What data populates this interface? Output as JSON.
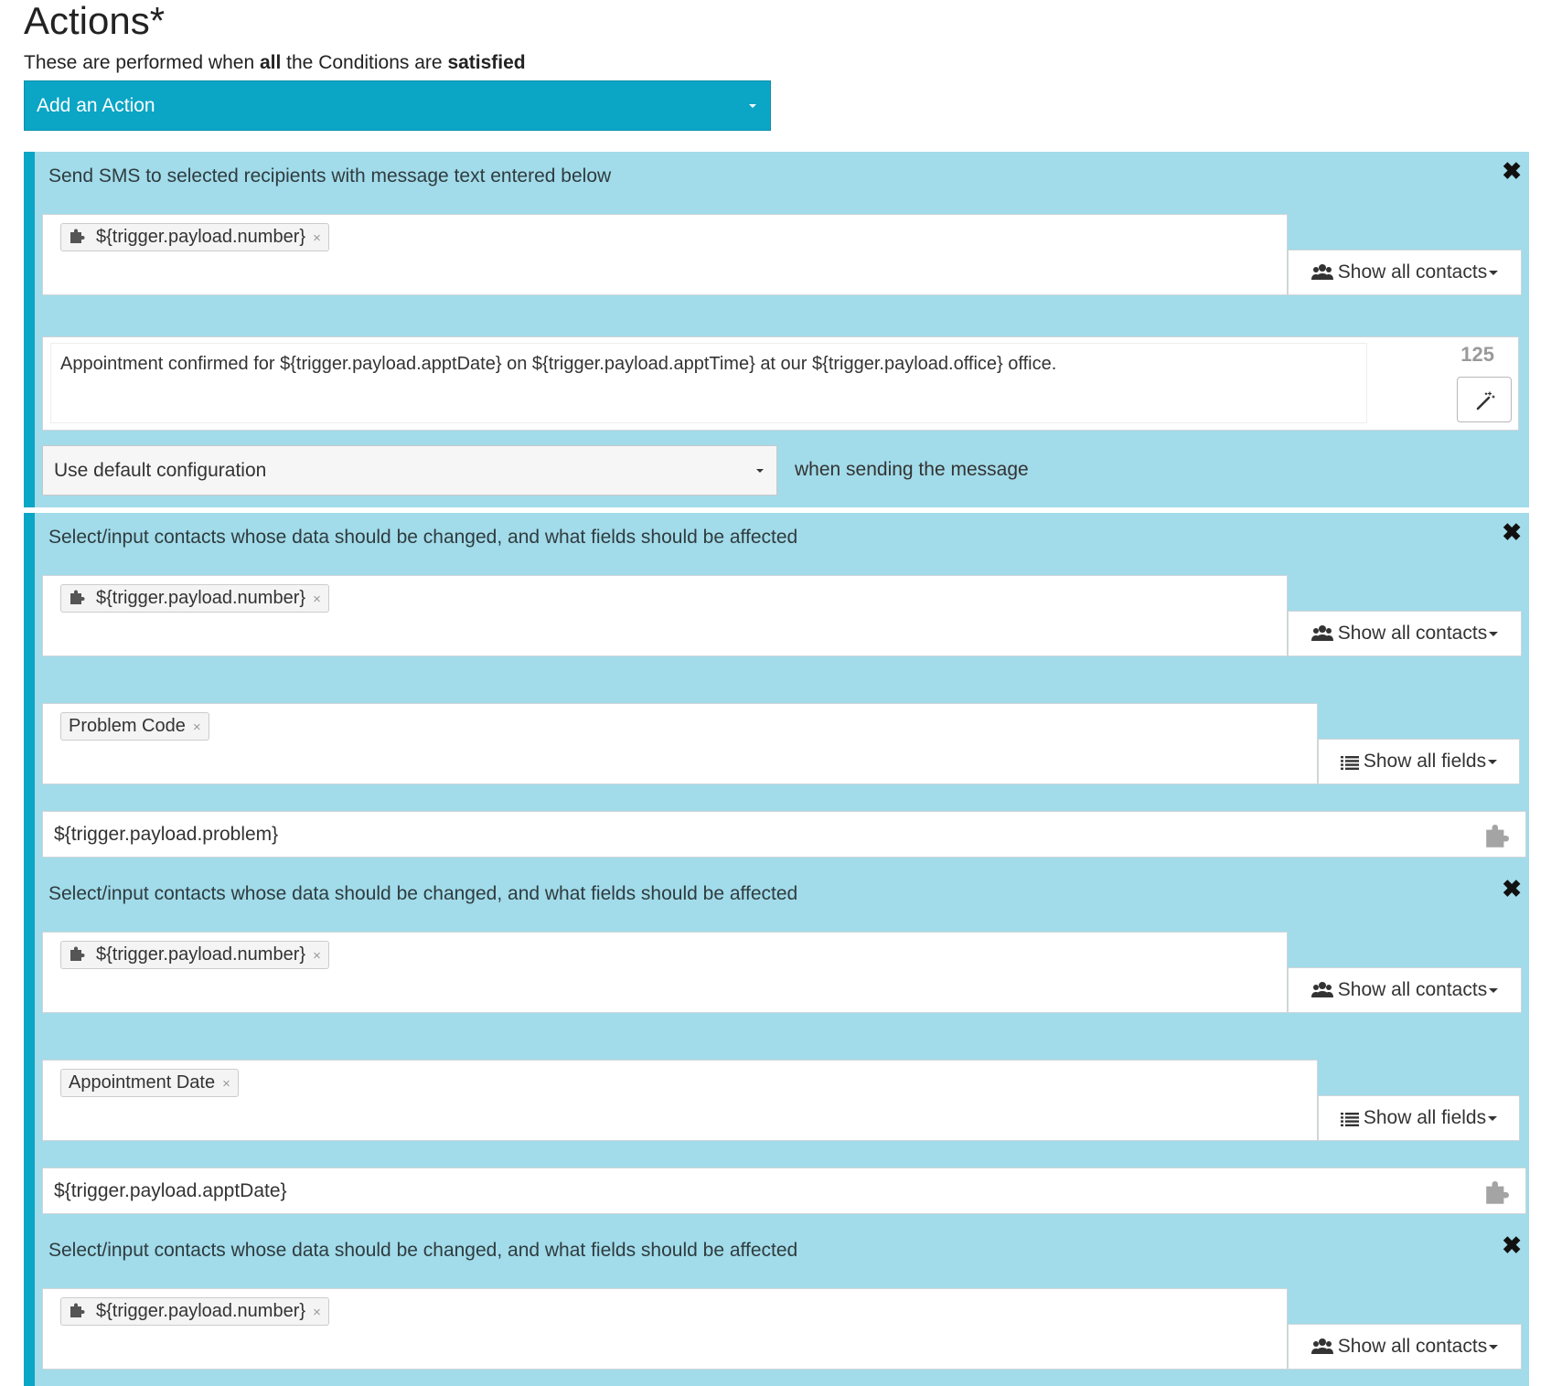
{
  "header": {
    "title": "Actions*",
    "desc_pre": "These are performed when ",
    "desc_bold1": "all",
    "desc_mid": " the Conditions are ",
    "desc_bold2": "satisfied"
  },
  "add_action": {
    "label": "Add an Action"
  },
  "panels": [
    {
      "title": "Send SMS to selected recipients with message text entered below",
      "close": "✖",
      "recipient_tag": "${trigger.payload.number}",
      "tag_remove": "×",
      "contacts_button": "Show all contacts",
      "message_text": "Appointment confirmed for ${trigger.payload.apptDate} on ${trigger.payload.apptTime} at our ${trigger.payload.office} office.",
      "char_count": "125",
      "config_select": "Use default configuration",
      "config_suffix": "when sending the message"
    },
    {
      "title": "Select/input contacts whose data should be changed, and what fields should be affected",
      "close": "✖",
      "contact_tag": "${trigger.payload.number}",
      "tag_remove": "×",
      "contacts_button": "Show all contacts",
      "field_tag": "Problem Code",
      "fields_button": "Show all fields",
      "value": "${trigger.payload.problem}"
    },
    {
      "title": "Select/input contacts whose data should be changed, and what fields should be affected",
      "close": "✖",
      "contact_tag": "${trigger.payload.number}",
      "tag_remove": "×",
      "contacts_button": "Show all contacts",
      "field_tag": "Appointment Date",
      "fields_button": "Show all fields",
      "value": "${trigger.payload.apptDate}"
    },
    {
      "title": "Select/input contacts whose data should be changed, and what fields should be affected",
      "close": "✖",
      "contact_tag": "${trigger.payload.number}",
      "tag_remove": "×",
      "contacts_button": "Show all contacts"
    }
  ],
  "colors": {
    "accent": "#0ba5c5",
    "panel_bg": "#a2dbe9"
  },
  "icons": {
    "tag_icon": "puzzle-icon",
    "contacts_icon": "users-icon",
    "fields_icon": "list-icon",
    "wand": "magic-wand-icon",
    "remove": "close-icon"
  }
}
